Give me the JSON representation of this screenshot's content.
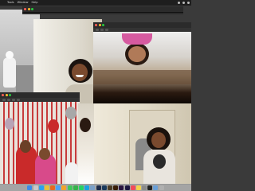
{
  "menubar": {
    "app_name": "Tools",
    "items": [
      "Window",
      "Help"
    ]
  },
  "windows": {
    "back": {
      "title": ""
    },
    "middle": {
      "title": ""
    },
    "front_top": {
      "title": ""
    },
    "bottom_left": {
      "title": ""
    }
  },
  "dock": {
    "apps": [
      {
        "icon": "finder-icon",
        "color": "#3b8be8"
      },
      {
        "icon": "launchpad-icon",
        "color": "#c9c9c9"
      },
      {
        "icon": "safari-icon",
        "color": "#2aa1f0"
      },
      {
        "icon": "chrome-icon",
        "color": "#e8c13a"
      },
      {
        "icon": "firefox-icon",
        "color": "#e66a1f"
      },
      {
        "icon": "mail-icon",
        "color": "#4aa3f5"
      },
      {
        "icon": "photos-icon",
        "color": "#f2a32b"
      },
      {
        "icon": "messages-icon",
        "color": "#3fc95a"
      },
      {
        "icon": "facetime-icon",
        "color": "#35b34a"
      },
      {
        "icon": "whatsapp-icon",
        "color": "#25d366"
      },
      {
        "icon": "skype-icon",
        "color": "#1aa3e0"
      },
      {
        "icon": "preview-icon",
        "color": "#7aa0c8"
      },
      {
        "icon": "lightroom-icon",
        "color": "#1f2c4a"
      },
      {
        "icon": "photoshop-icon",
        "color": "#1b3a5c"
      },
      {
        "icon": "bridge-icon",
        "color": "#4d3c24"
      },
      {
        "icon": "illustrator-icon",
        "color": "#3a1f08"
      },
      {
        "icon": "premiere-icon",
        "color": "#2a1540"
      },
      {
        "icon": "after-effects-icon",
        "color": "#1c1740"
      },
      {
        "icon": "music-icon",
        "color": "#f24a5a"
      },
      {
        "icon": "notes-icon",
        "color": "#f5d34a"
      },
      {
        "icon": "settings-icon",
        "color": "#8a8a8a"
      },
      {
        "icon": "terminal-icon",
        "color": "#222222"
      },
      {
        "icon": "downloads-icon",
        "color": "#6aa0d8"
      },
      {
        "icon": "trash-icon",
        "color": "#b0b0b0"
      }
    ]
  }
}
